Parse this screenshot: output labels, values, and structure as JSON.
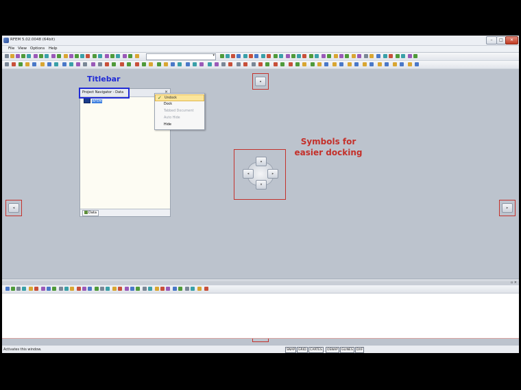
{
  "window": {
    "title": "RFEM 5.02.0048 (64bit)",
    "minimize_label": "–",
    "maximize_label": "□",
    "close_label": "✕"
  },
  "menu": {
    "items": [
      {
        "label": "File"
      },
      {
        "label": "View"
      },
      {
        "label": "Options"
      },
      {
        "label": "Help"
      }
    ]
  },
  "toolbar": {
    "combo_value": "",
    "combo_arrow": "▾"
  },
  "navigator": {
    "title": "Project Navigator - Data",
    "close_label": "×",
    "tree_root": "RFEM",
    "tab_label": "Data"
  },
  "context_menu": {
    "items": [
      {
        "label": "Undock",
        "checked": true,
        "enabled": true
      },
      {
        "label": "Dock",
        "checked": false,
        "enabled": true
      },
      {
        "label": "Tabbed Document",
        "checked": false,
        "enabled": false
      },
      {
        "label": "Auto Hide",
        "checked": false,
        "enabled": false
      },
      {
        "label": "Hide",
        "checked": false,
        "enabled": true
      }
    ],
    "check_glyph": "✓"
  },
  "annotations": {
    "titlebar": "Titlebar",
    "docking_line1": "Symbols for",
    "docking_line2": "easier docking"
  },
  "dock_arrows": {
    "top": "▴",
    "left": "◂",
    "right": "▸",
    "bottom": "▾"
  },
  "lower_panel": {
    "pin_close": "▫ ×"
  },
  "statusbar": {
    "text": "Activates this window.",
    "toggles": [
      "SNAP",
      "GRID",
      "CARTES",
      "OSNAP",
      "GLINES",
      "DXF"
    ]
  },
  "colors": {
    "annotation_red": "#c4302a",
    "annotation_blue": "#1f2ad6",
    "workspace": "#bcc3cd"
  }
}
